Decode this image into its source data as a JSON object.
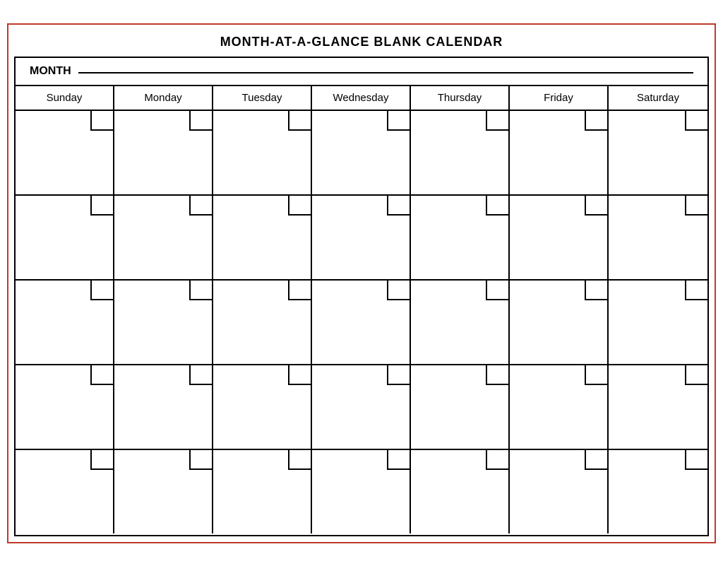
{
  "title": "MONTH-AT-A-GLANCE  BLANK  CALENDAR",
  "month_label": "MONTH",
  "days": [
    "Sunday",
    "Monday",
    "Tuesday",
    "Wednesday",
    "Thursday",
    "Friday",
    "Saturday"
  ],
  "weeks": [
    {
      "id": "week-1"
    },
    {
      "id": "week-2"
    },
    {
      "id": "week-3"
    },
    {
      "id": "week-4"
    },
    {
      "id": "week-5"
    }
  ]
}
